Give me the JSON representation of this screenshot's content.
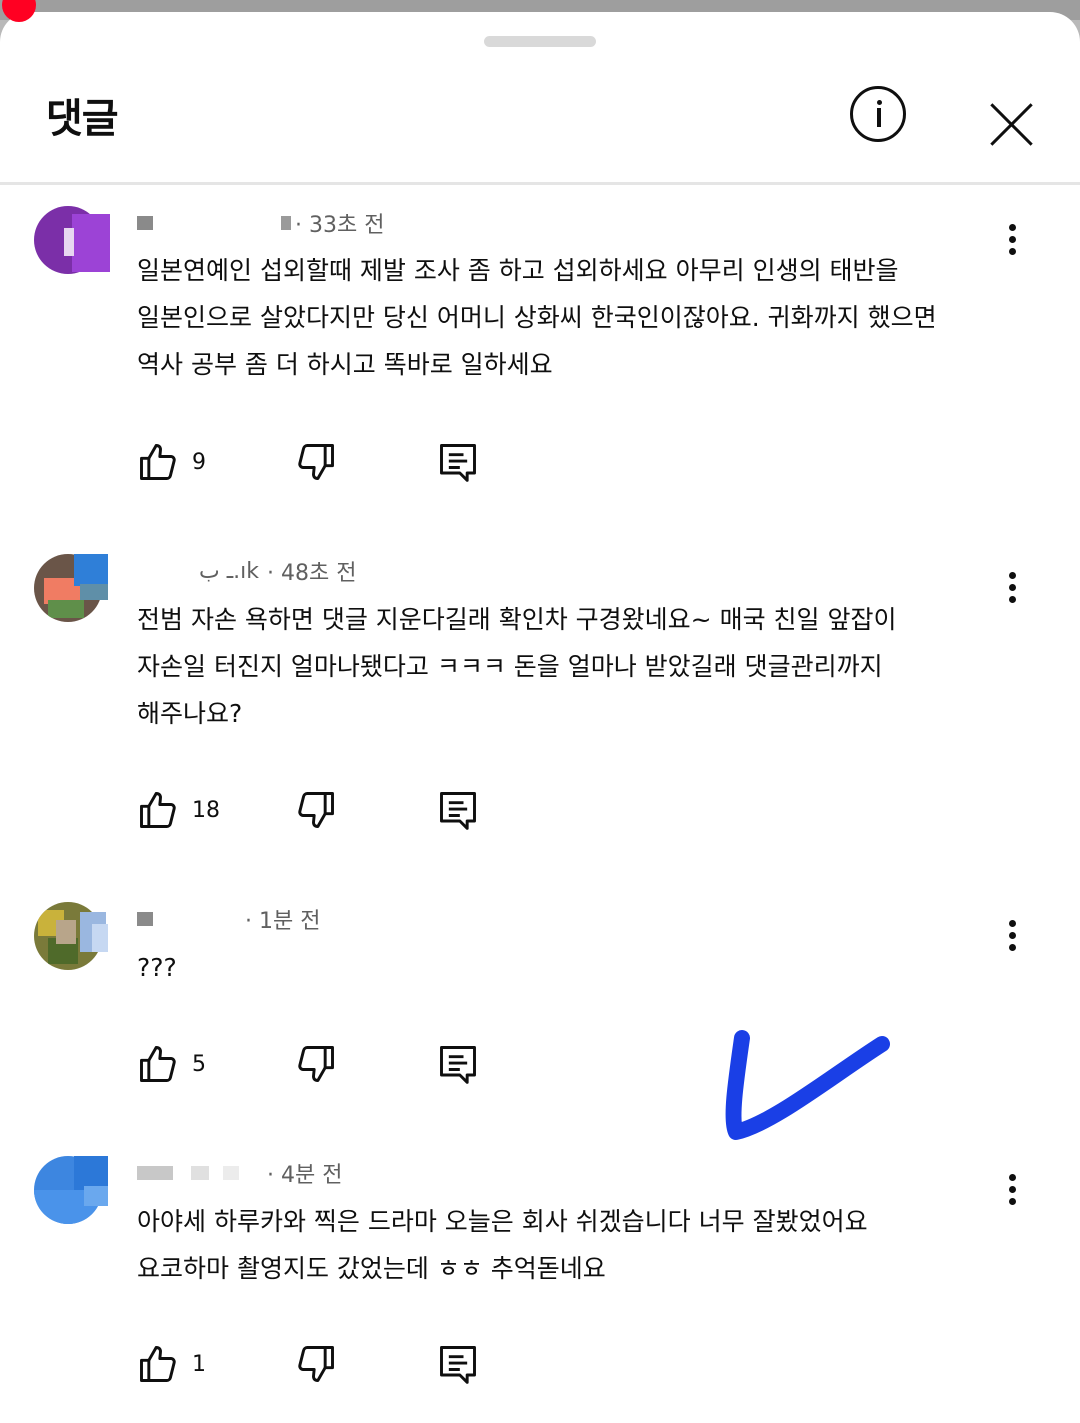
{
  "panel": {
    "title": "댓글",
    "info_icon": "info-circle-icon",
    "close_icon": "close-x-icon"
  },
  "comments": [
    {
      "author_fragment": "",
      "time": "· 33초 전",
      "lines": [
        "일본연예인 섭외할때 제발 조사 좀 하고 섭외하세요 아무리 인생의 태반을",
        "일본인으로 살았다지만 당신 어머니 상화씨 한국인이잖아요. 귀화까지 했으면",
        "역사 공부 좀 더 하시고 똑바로 일하세요"
      ],
      "likes": "9"
    },
    {
      "author_fragment": "ـ ب.ık",
      "time": "· 48초 전",
      "lines": [
        "전범 자손 욕하면 댓글 지운다길래 확인차 구경왔네요~ 매국 친일 앞잡이",
        "자손일 터진지 얼마나됐다고 ㅋㅋㅋ 돈을 얼마나 받았길래 댓글관리까지",
        "해주나요?"
      ],
      "likes": "18"
    },
    {
      "author_fragment": "",
      "time": "· 1분 전",
      "lines": [
        "???"
      ],
      "likes": "5"
    },
    {
      "author_fragment": "",
      "time": "· 4분 전",
      "lines": [
        "아야세 하루카와 찍은 드라마 오늘은 회사 쉬겠습니다 너무 잘봤었어요",
        "요코하마 촬영지도 갔었는데 ㅎㅎ 추억돋네요"
      ],
      "likes": "1"
    }
  ],
  "icons": {
    "like": "thumbs-up-icon",
    "dislike": "thumbs-down-icon",
    "reply": "reply-comment-icon",
    "more": "more-vertical-icon"
  },
  "colors": {
    "record_dot": "#ff0022",
    "annotation_stroke": "#1a3fe6",
    "meta_text": "#606060"
  }
}
